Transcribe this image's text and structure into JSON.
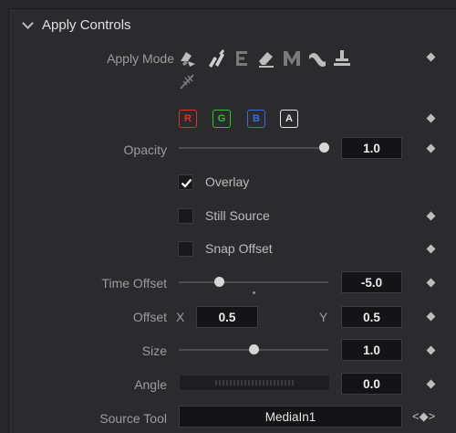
{
  "section": {
    "title": "Apply Controls"
  },
  "apply_mode": {
    "label": "Apply Mode",
    "icons": [
      "paint-normal-icon",
      "paint-brush-icon",
      "emboss-icon",
      "erase-icon",
      "merge-icon",
      "smear-icon",
      "stamp-icon",
      "wire-icon"
    ]
  },
  "channels": [
    {
      "label": "R",
      "color": "#e03030"
    },
    {
      "label": "G",
      "color": "#2ec02e"
    },
    {
      "label": "B",
      "color": "#3a6fe0"
    },
    {
      "label": "A",
      "color": "#e6e6e6"
    }
  ],
  "opacity": {
    "label": "Opacity",
    "value": "1.0",
    "slider_fraction": 1.0
  },
  "overlay": {
    "label": "Overlay",
    "checked": true
  },
  "still_source": {
    "label": "Still Source",
    "checked": false
  },
  "snap_offset": {
    "label": "Snap Offset",
    "checked": false
  },
  "time_offset": {
    "label": "Time Offset",
    "value": "-5.0"
  },
  "offset": {
    "label": "Offset",
    "x_label": "X",
    "x_value": "0.5",
    "y_label": "Y",
    "y_value": "0.5"
  },
  "size": {
    "label": "Size",
    "value": "1.0"
  },
  "angle": {
    "label": "Angle",
    "value": "0.0"
  },
  "source_tool": {
    "label": "Source Tool",
    "value": "MediaIn1",
    "nav": "<◆>"
  },
  "colors": {
    "accent_knob": "#d6d6d6",
    "bg": "#2b2b2e"
  }
}
